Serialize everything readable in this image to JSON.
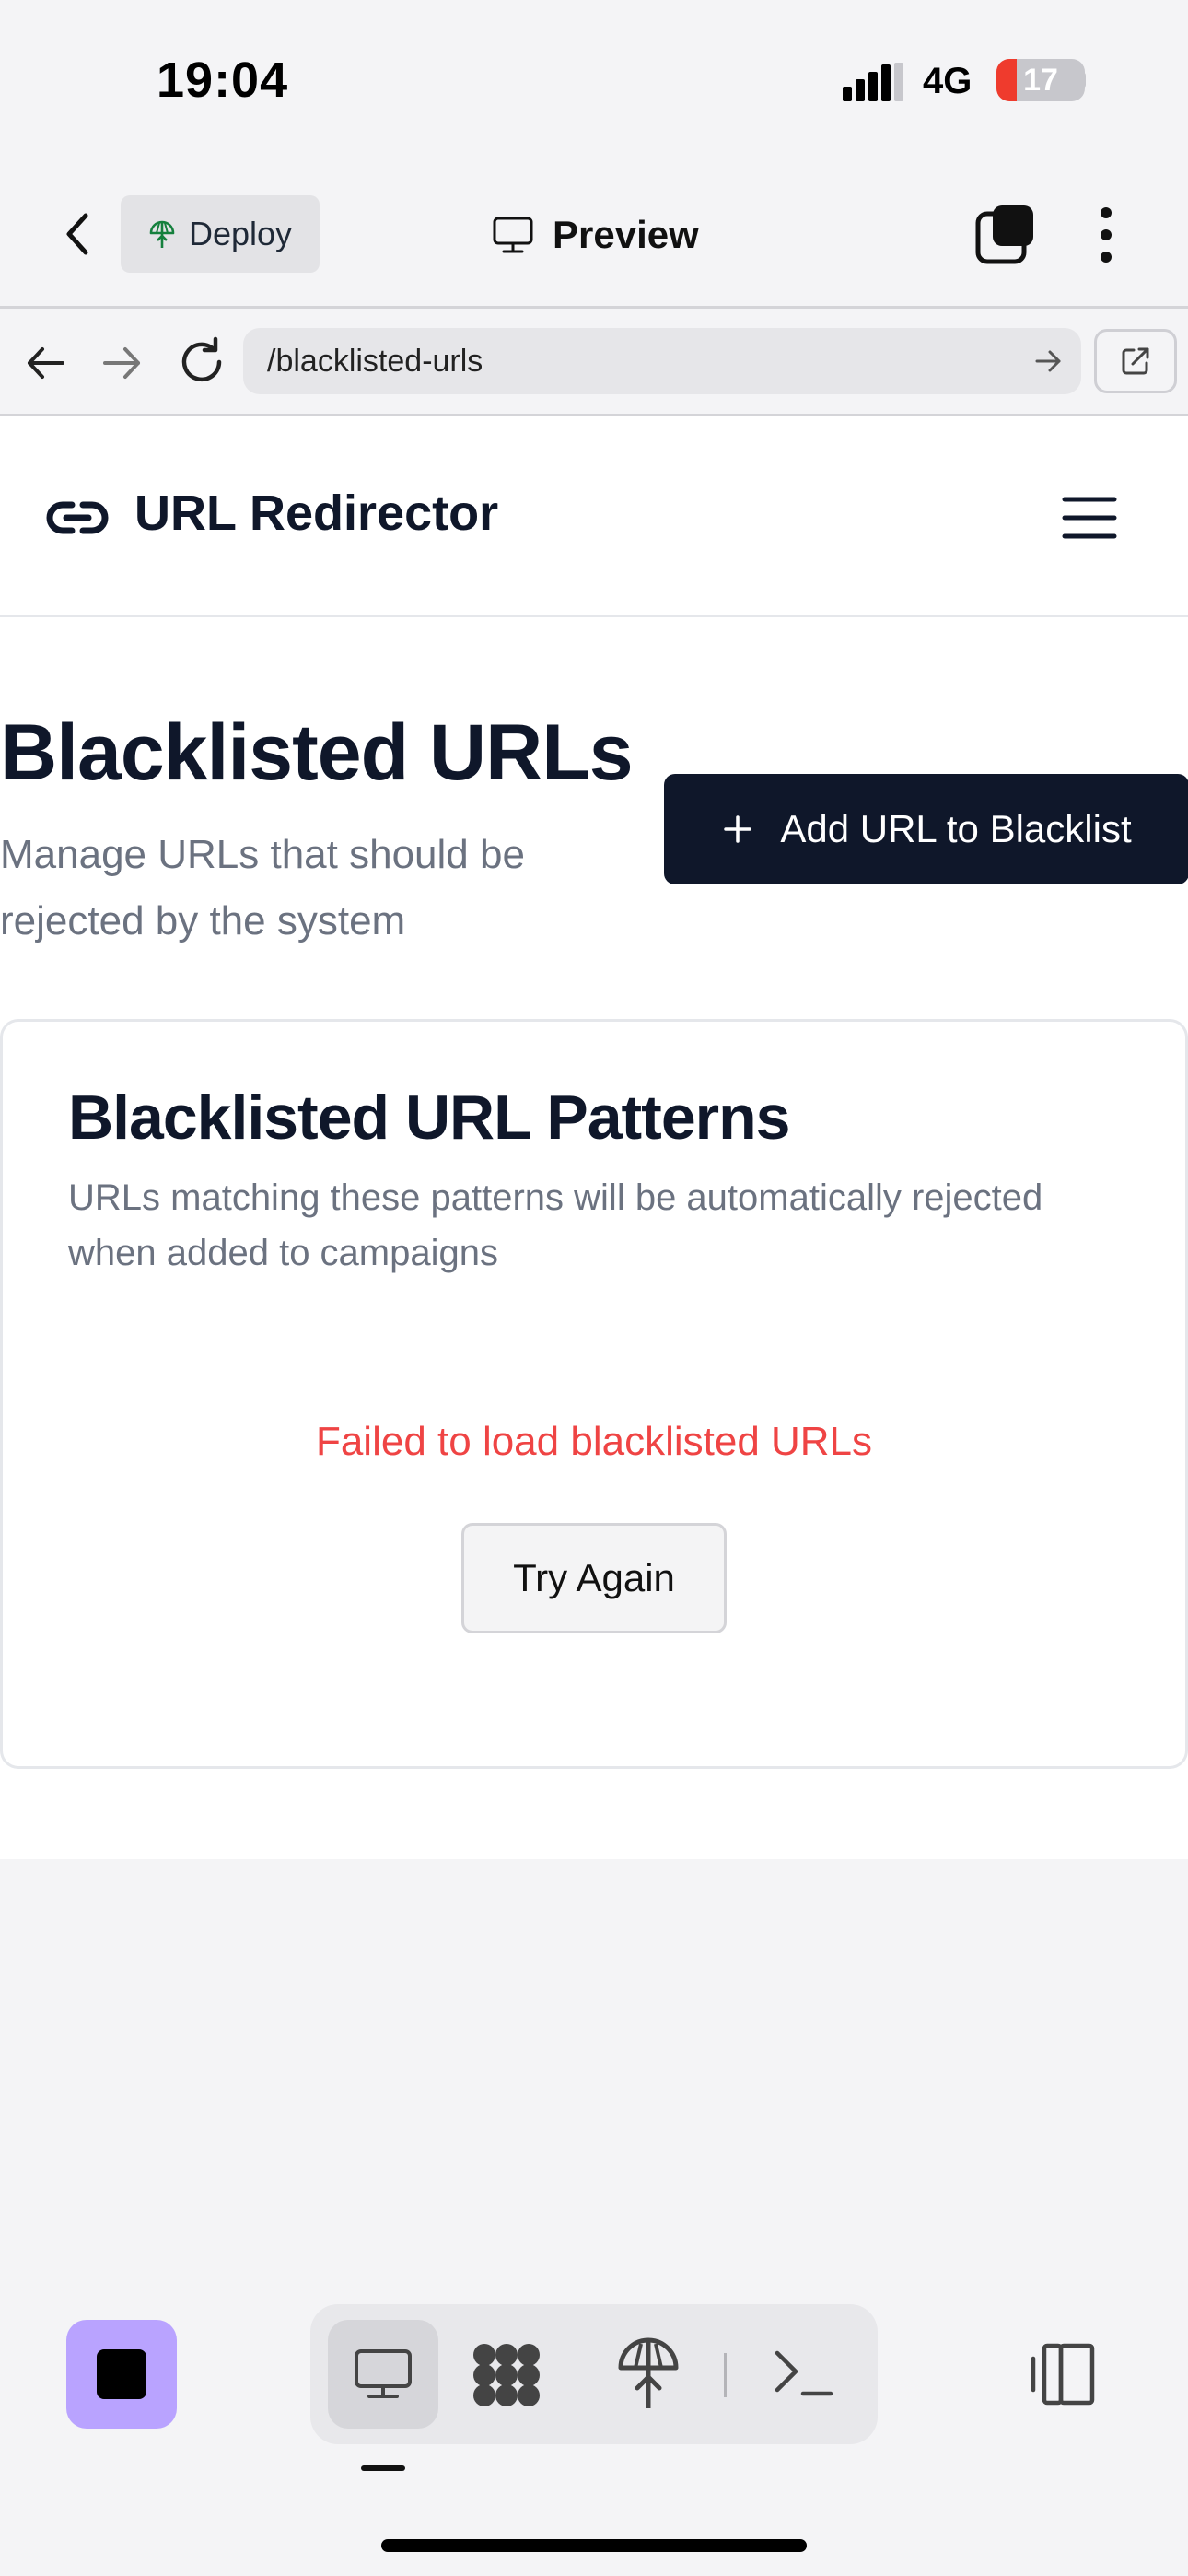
{
  "status_bar": {
    "time": "19:04",
    "network": "4G",
    "battery": "17"
  },
  "app_header": {
    "deploy_label": "Deploy",
    "preview_label": "Preview"
  },
  "browser": {
    "url": "/blacklisted-urls"
  },
  "site": {
    "title": "URL Redirector"
  },
  "page": {
    "heading": "Blacklisted URLs",
    "subtitle": "Manage URLs that should be rejected by the system",
    "add_button_label": "Add URL to Blacklist"
  },
  "card": {
    "title": "Blacklisted URL Patterns",
    "description": "URLs matching these patterns will be automatically rejected when added to campaigns",
    "error_message": "Failed to load blacklisted URLs",
    "retry_label": "Try Again"
  },
  "colors": {
    "primary": "#0f172a",
    "error": "#ef4444",
    "muted_text": "#6b7280",
    "stop_button": "#b9a3ff",
    "battery_low": "#ef3b2d"
  },
  "icons": {
    "back": "chevron-left-icon",
    "deploy": "deploy-icon",
    "preview": "monitor-icon",
    "tabs": "tabs-icon",
    "more": "more-vertical-icon",
    "nav_back": "arrow-left-icon",
    "nav_forward": "arrow-right-icon",
    "reload": "reload-icon",
    "open_external": "external-link-icon",
    "site_logo": "link-icon",
    "menu": "hamburger-icon",
    "add": "plus-icon",
    "console": "terminal-icon",
    "agents": "agents-icon",
    "panel": "panel-toggle-icon"
  }
}
